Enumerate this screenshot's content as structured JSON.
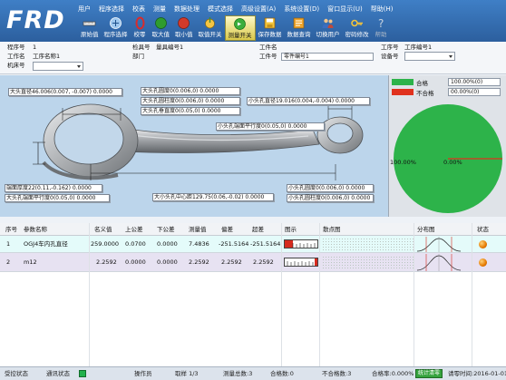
{
  "app": {
    "logo": "FRD"
  },
  "menu": [
    "用户",
    "程序选择",
    "校表",
    "测量",
    "数据处理",
    "模式选择",
    "高级设置(A)",
    "系统设置(D)",
    "窗口显示(U)",
    "帮助(H)"
  ],
  "toolbar": [
    {
      "label": "原始值",
      "icon": "ruler-icon"
    },
    {
      "label": "程序选择",
      "icon": "program-icon"
    },
    {
      "label": "校零",
      "icon": "zero-icon"
    },
    {
      "label": "取大值",
      "icon": "max-icon"
    },
    {
      "label": "取小值",
      "icon": "min-icon"
    },
    {
      "label": "取值开关",
      "icon": "switch-icon"
    },
    {
      "label": "测量开关",
      "icon": "measure-icon",
      "active": true
    },
    {
      "label": "保存数据",
      "icon": "save-icon"
    },
    {
      "label": "数据查询",
      "icon": "query-icon"
    },
    {
      "label": "切换用户",
      "icon": "user-icon"
    },
    {
      "label": "密码修改",
      "icon": "password-icon"
    },
    {
      "label": "帮助",
      "icon": "help-icon",
      "disabled": true
    }
  ],
  "info": {
    "program_no_label": "程序号",
    "program_no": "1",
    "inspect_no_label": "检具号",
    "gauge_no_label": "量具编号1",
    "workpiece_name_label": "工件名",
    "process_no_label": "工序号",
    "process_code_label": "工序编号1",
    "station_label": "工作名",
    "station_value": "工序名称1",
    "dept_label": "部门",
    "workpiece_no_label": "工件号",
    "workpiece_no": "零件编号1",
    "equipment_label": "设备号",
    "machine_label": "机床号"
  },
  "drawing_labels": [
    {
      "text": "大头直径46.006(0.007, -0.007)  0.0000"
    },
    {
      "text": "大头孔圆度0(0.006,0)   0.0000"
    },
    {
      "text": "大头孔圆柱度0(0.006,0) 0.0000"
    },
    {
      "text": "大头孔垂直度0(0.05,0)  0.0000"
    },
    {
      "text": "小头孔直径19.016(0.004,-0.004)  0.0000"
    },
    {
      "text": "小头孔端面平行度0(0.05,0)  0.0000"
    },
    {
      "text": "端面厚度22(0.11,-0.162)   0.0000"
    },
    {
      "text": "大头孔端面平行度0(0.05,0) 0.0000"
    },
    {
      "text": "大小头孔中心距129.75(0.06,-0.02)  0.0000"
    },
    {
      "text": "小头孔圆度0(0.006,0)   0.0000"
    },
    {
      "text": "小头孔圆柱度0(0.006,0) 0.0000"
    }
  ],
  "summary": {
    "pass_label": "合格",
    "pass_value": "100.00%(0)",
    "fail_label": "不合格",
    "fail_value": "00.00%(0)",
    "pie_left_label": "100.00%",
    "pie_right_label": "0.00%",
    "pass_color": "#2db34a",
    "fail_color": "#e0321e"
  },
  "chart_data": {
    "type": "pie",
    "categories": [
      "合格",
      "不合格"
    ],
    "values": [
      100,
      0
    ]
  },
  "table": {
    "headers": [
      "序号",
      "参数名称",
      "名义值",
      "上公差",
      "下公差",
      "测量值",
      "偏差",
      "超差",
      "图示",
      "散点图",
      "分布图",
      "状态"
    ],
    "rows": [
      {
        "no": "1",
        "name": "OGJ4车内孔直径",
        "nominal": "259.0000",
        "upper": "0.0700",
        "lower": "0.0000",
        "measured": "7.4836",
        "deviation": "-251.5164",
        "over": "-251.5164"
      },
      {
        "no": "2",
        "name": "m12",
        "nominal": "2.2592",
        "upper": "0.0000",
        "lower": "0.0000",
        "measured": "2.2592",
        "deviation": "2.2592",
        "over": "2.2592"
      }
    ]
  },
  "statusbar": {
    "sensor": "受控状态",
    "comm": "通讯状态",
    "operator": "操作员",
    "sample": "取样 1/3",
    "total": "测量总数:3",
    "pass": "合格数:0",
    "fail": "不合格数:3",
    "pass_rate": "合格率:0.000%",
    "clear_btn": "统计清零",
    "time": "请零时间:2016-01-01"
  }
}
